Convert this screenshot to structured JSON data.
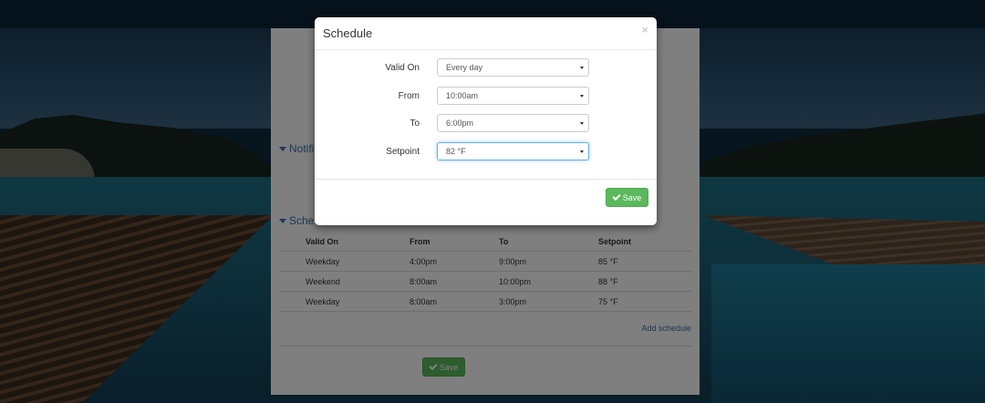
{
  "page": {
    "sections": {
      "notifications_label": "Notifi",
      "schedule_label": "Sche"
    },
    "schedule_table": {
      "headers": [
        "Valid On",
        "From",
        "To",
        "Setpoint"
      ],
      "rows": [
        [
          "Weekday",
          "4:00pm",
          "9:00pm",
          "85 °F"
        ],
        [
          "Weekend",
          "8:00am",
          "10:00pm",
          "88 °F"
        ],
        [
          "Weekday",
          "8:00am",
          "3:00pm",
          "75 °F"
        ]
      ]
    },
    "add_schedule": "Add schedule",
    "save_label": "Save"
  },
  "modal": {
    "title": "Schedule",
    "close_symbol": "×",
    "fields": {
      "valid_on": {
        "label": "Valid On",
        "value": "Every day"
      },
      "from": {
        "label": "From",
        "value": "10:00am"
      },
      "to": {
        "label": "To",
        "value": "6:00pm"
      },
      "setpoint": {
        "label": "Setpoint",
        "value": "82 °F"
      }
    },
    "save_label": "Save"
  },
  "colors": {
    "accent": "#3a6ea5",
    "save_green": "#5cb85c",
    "focus_blue": "#66afe9"
  },
  "icons": {
    "check": "check-icon",
    "caret": "caret-down-icon",
    "close": "close-icon"
  }
}
